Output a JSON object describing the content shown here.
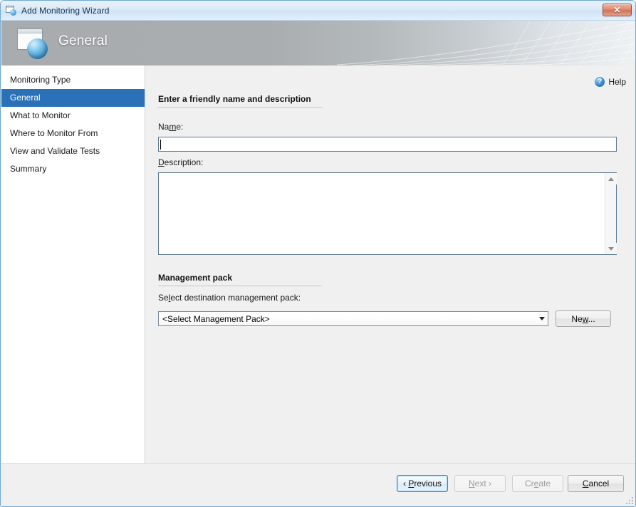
{
  "window": {
    "title": "Add Monitoring Wizard",
    "close_label": "✕",
    "icon": "window-sphere-icon"
  },
  "banner": {
    "title": "General",
    "icon": "window-sphere-icon"
  },
  "sidebar": {
    "items": [
      {
        "label": "Monitoring Type",
        "selected": false
      },
      {
        "label": "General",
        "selected": true
      },
      {
        "label": "What to Monitor",
        "selected": false
      },
      {
        "label": "Where to Monitor From",
        "selected": false
      },
      {
        "label": "View and Validate Tests",
        "selected": false
      },
      {
        "label": "Summary",
        "selected": false
      }
    ]
  },
  "help": {
    "label": "Help",
    "icon_glyph": "?"
  },
  "main": {
    "section_name": {
      "header": "Enter a friendly name and description",
      "name_label_pre": "Na",
      "name_label_acc": "m",
      "name_label_post": "e:",
      "name_value": "",
      "desc_label_acc": "D",
      "desc_label_post": "escription:",
      "desc_value": ""
    },
    "section_mp": {
      "header": "Management pack",
      "select_label_pre": "Se",
      "select_label_acc": "l",
      "select_label_post": "ect destination management pack:",
      "dropdown_value": "<Select Management Pack>",
      "new_button_pre": "Ne",
      "new_button_acc": "w",
      "new_button_post": "..."
    }
  },
  "footer": {
    "previous": {
      "pre": "‹ ",
      "acc": "P",
      "post": "revious",
      "state": "focused"
    },
    "next": {
      "pre": "",
      "acc": "N",
      "post": "ext ›",
      "state": "disabled"
    },
    "create": {
      "pre": "Cr",
      "acc": "e",
      "post": "ate",
      "state": "disabled"
    },
    "cancel": {
      "pre": "",
      "acc": "C",
      "post": "ancel",
      "state": "normal"
    }
  },
  "colors": {
    "accent_blue": "#2b71b8",
    "banner_gray": "#a8acae",
    "content_bg": "#f0f0f0",
    "close_red": "#cf7255"
  }
}
